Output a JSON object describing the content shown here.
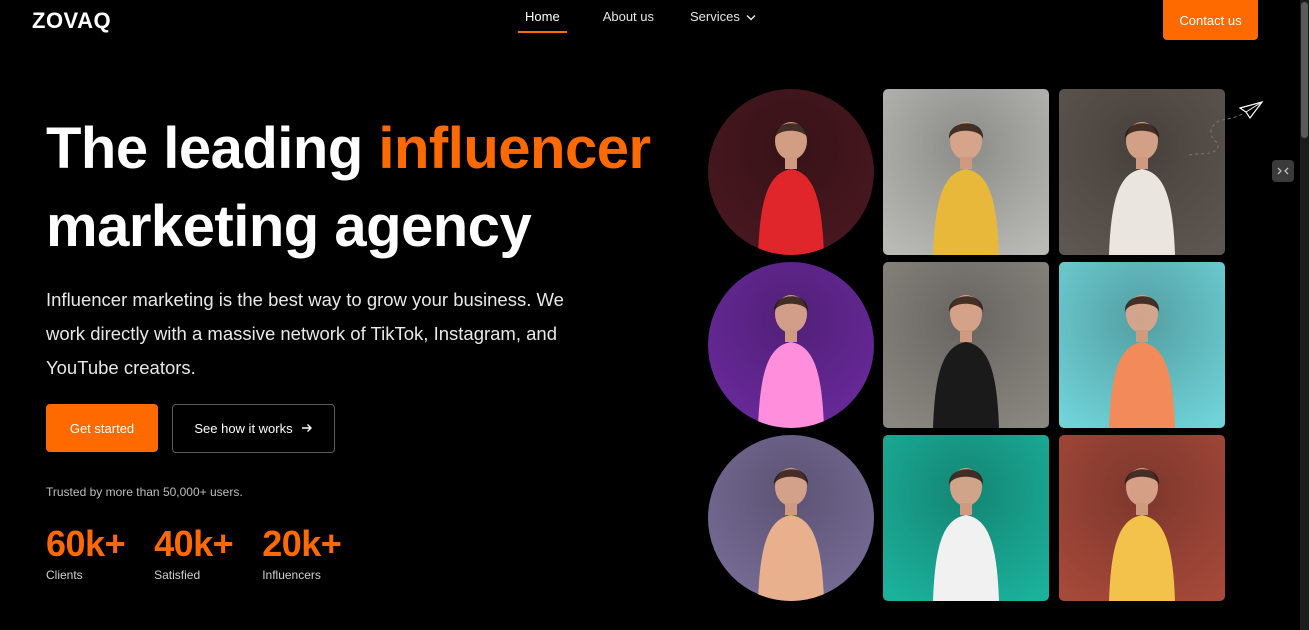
{
  "header": {
    "logo": "ZOVAQ",
    "nav": [
      {
        "label": "Home",
        "active": true
      },
      {
        "label": "About us",
        "active": false
      },
      {
        "label": "Services",
        "active": false,
        "has_dropdown": true
      }
    ],
    "contact_label": "Contact us"
  },
  "hero": {
    "title_part1": "The leading ",
    "title_accent": "influencer",
    "title_part2": "marketing agency",
    "description": "Influencer marketing is the best way to grow your business. We work directly with a massive network of TikTok, Instagram, and YouTube creators.",
    "primary_button": "Get started",
    "secondary_button": "See how it works",
    "trusted_text": "Trusted by more than 50,000+ users."
  },
  "stats": [
    {
      "value": "60k+",
      "label": "Clients"
    },
    {
      "value": "40k+",
      "label": "Satisfied"
    },
    {
      "value": "20k+",
      "label": "Influencers"
    }
  ],
  "gallery": [
    {
      "name": "influencer-photo-red-dress",
      "shape": "circle",
      "bg": "#4a1820",
      "accent": "#e0262b"
    },
    {
      "name": "influencer-photo-yellow-outfit",
      "shape": "square",
      "bg": "#b9b9b5",
      "accent": "#e8b83a"
    },
    {
      "name": "influencer-photo-white-suit",
      "shape": "square",
      "bg": "#5e5650",
      "accent": "#eae6df"
    },
    {
      "name": "influencer-photo-neon-portrait",
      "shape": "circle",
      "bg": "#6b2a9e",
      "accent": "#ff8fdc"
    },
    {
      "name": "influencer-photo-black-coat",
      "shape": "square",
      "bg": "#8a8680",
      "accent": "#1a1a1a"
    },
    {
      "name": "influencer-photo-slide",
      "shape": "square",
      "bg": "#6fd3d8",
      "accent": "#f28a5a"
    },
    {
      "name": "influencer-photo-blonde-portrait",
      "shape": "circle",
      "bg": "#7a6e99",
      "accent": "#e9b08e"
    },
    {
      "name": "influencer-photo-teal-striped",
      "shape": "square",
      "bg": "#1bb19b",
      "accent": "#f1f1f1"
    },
    {
      "name": "influencer-photo-red-hair-phone",
      "shape": "square",
      "bg": "#a5493a",
      "accent": "#f2c24a"
    }
  ],
  "colors": {
    "accent": "#ff6a00",
    "background": "#000000"
  }
}
